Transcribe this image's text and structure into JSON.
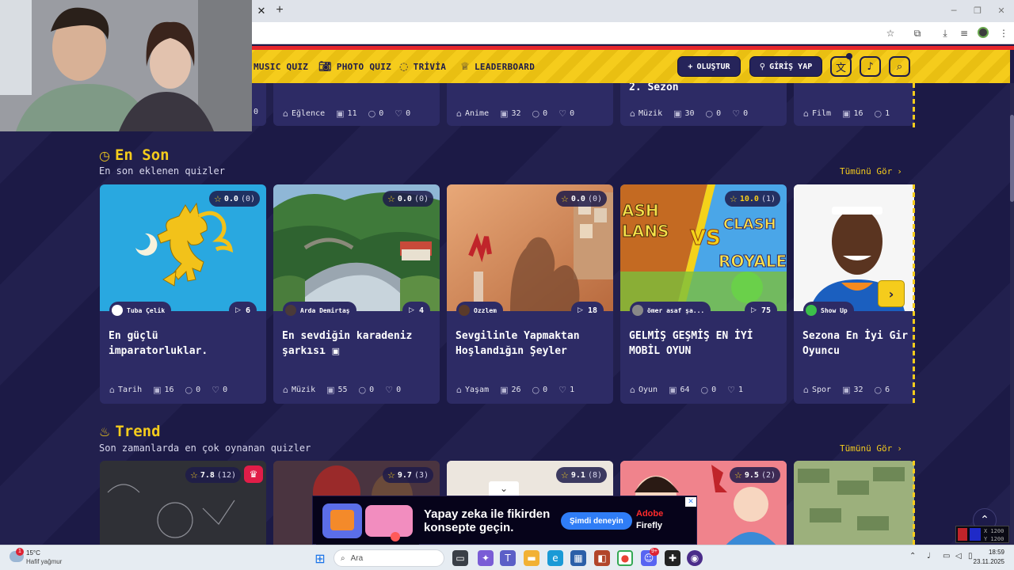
{
  "site_nav": {
    "items": [
      {
        "label": "MUSIC QUIZ",
        "icon": "music-icon"
      },
      {
        "label": "PHOTO QUIZ",
        "icon": "camera-icon"
      },
      {
        "label": "TRİVİA",
        "icon": "chat-question-icon"
      },
      {
        "label": "LEADERBOARD",
        "icon": "trophy-icon"
      }
    ],
    "create_label": "OLUŞTUR",
    "login_label": "GİRİŞ YAP"
  },
  "top_row": [
    {
      "category": "",
      "views": "",
      "comments": "",
      "likes": "0"
    },
    {
      "category": "Eğlence",
      "views": "11",
      "comments": "0",
      "likes": "0"
    },
    {
      "category": "Anime",
      "views": "32",
      "comments": "0",
      "likes": "0"
    },
    {
      "title": "2. Sezon",
      "category": "Müzik",
      "views": "30",
      "comments": "0",
      "likes": "0"
    },
    {
      "category": "Film",
      "views": "16",
      "comments": "1",
      "likes": ""
    }
  ],
  "sections": {
    "latest": {
      "title": "En Son",
      "subtitle": "En son eklenen quizler",
      "see_all": "Tümünü Gör",
      "cards": [
        {
          "rating": "0.0",
          "rating_count": "(0)",
          "author": "Tuba Çelik",
          "plays": "6",
          "title_line1": "En güçlü",
          "title_line2": "imparatorluklar.",
          "category": "Tarih",
          "views": "16",
          "comments": "0",
          "likes": "0"
        },
        {
          "rating": "0.0",
          "rating_count": "(0)",
          "author": "Arda Demirtaş",
          "plays": "4",
          "title_line1": "En sevdiğin karadeniz",
          "title_line2": "şarkısı",
          "category": "Müzik",
          "views": "55",
          "comments": "0",
          "likes": "0"
        },
        {
          "rating": "0.0",
          "rating_count": "(0)",
          "author": "Ozzlem",
          "plays": "18",
          "title_line1": "Sevgilinle Yapmaktan",
          "title_line2": "Hoşlandığın Şeyler",
          "category": "Yaşam",
          "views": "26",
          "comments": "0",
          "likes": "1"
        },
        {
          "rating": "10.0",
          "rating_count": "(1)",
          "author": "ömer asaf şa...",
          "plays": "75",
          "title_line1": "GELMİŞ GEŞMİŞ EN İYİ",
          "title_line2": "MOBİL OYUN",
          "category": "Oyun",
          "views": "64",
          "comments": "0",
          "likes": "1"
        },
        {
          "rating": "",
          "rating_count": "",
          "author": "Show Up",
          "plays": "",
          "title_line1": "Sezona En İyi Gir",
          "title_line2": "Oyuncu",
          "category": "Spor",
          "views": "32",
          "comments": "6",
          "likes": ""
        }
      ]
    },
    "trend": {
      "title": "Trend",
      "subtitle": "Son zamanlarda en çok oynanan quizler",
      "see_all": "Tümünü Gör",
      "cards": [
        {
          "rating": "7.8",
          "rating_count": "(12)"
        },
        {
          "rating": "9.7",
          "rating_count": "(3)"
        },
        {
          "rating": "9.1",
          "rating_count": "(8)"
        },
        {
          "rating": "9.5",
          "rating_count": "(2)"
        }
      ]
    }
  },
  "thumb_text": {
    "clash_left_1": "ASH",
    "clash_left_2": "LANS",
    "clash_vs": "VS",
    "clash_right_1": "CLASH",
    "clash_right_2": "ROYALE"
  },
  "ad": {
    "headline_line1": "Yapay zeka ile fikirden",
    "headline_line2": "konsepte geçin.",
    "cta": "Şimdi deneyin",
    "brand_line1": "Adobe",
    "brand_line2": "Firefly"
  },
  "overlay": {
    "line1": "X 1200",
    "line2": "Y 1200"
  },
  "taskbar": {
    "weather_temp": "15°C",
    "weather_desc": "Hafif yağmur",
    "weather_badge": "1",
    "search_placeholder": "Ara",
    "discord_badge": "9+",
    "time": "18:59",
    "date": "23.11.2025"
  },
  "colors": {
    "background": "#1d1b4a",
    "card": "#2d2b65",
    "accent_yellow": "#f5cc1c",
    "nav_red": "#e6262c"
  }
}
